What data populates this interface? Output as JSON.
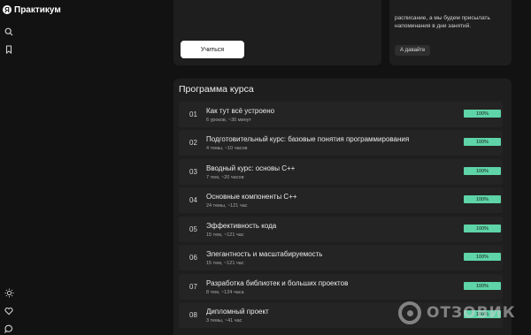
{
  "brand": {
    "logo_letter": "Я",
    "name": "Практикум"
  },
  "sidebar": {
    "icons": [
      "search-icon",
      "bookmark-icon",
      "sun-icon",
      "heart-icon",
      "chat-icon"
    ]
  },
  "top_left_card": {
    "button_label": "Учиться"
  },
  "top_right_card": {
    "text": "расписание, а мы будем присылать напоминания в дни занятий.",
    "button_label": "А давайте"
  },
  "program": {
    "title": "Программа курса",
    "modules": [
      {
        "num": "01",
        "title": "Как тут всё устроено",
        "meta": "6 уроков, ~30 минут",
        "progress": "100%"
      },
      {
        "num": "02",
        "title": "Подготовительный курс: базовые понятия программирования",
        "meta": "4 темы, ~10 часов",
        "progress": "100%"
      },
      {
        "num": "03",
        "title": "Вводный курс: основы C++",
        "meta": "7 тем, ~20 часов",
        "progress": "100%"
      },
      {
        "num": "04",
        "title": "Основные компоненты C++",
        "meta": "24 темы, ~121 час",
        "progress": "100%"
      },
      {
        "num": "05",
        "title": "Эффективность кода",
        "meta": "15 тем, ~121 час",
        "progress": "100%"
      },
      {
        "num": "06",
        "title": "Элегантность и масштабируемость",
        "meta": "15 тем, ~121 час",
        "progress": "100%"
      },
      {
        "num": "07",
        "title": "Разработка библиотек и больших проектов",
        "meta": "8 тем, ~124 часа",
        "progress": "100%"
      },
      {
        "num": "08",
        "title": "Дипломный проект",
        "meta": "3 темы, ~41 час",
        "progress": "100%"
      }
    ]
  },
  "watermark": {
    "text": "ОТЗОВИК"
  },
  "colors": {
    "background": "#121212",
    "card": "#1e1e1e",
    "row": "#242424",
    "progress": "#5ed4a8"
  }
}
